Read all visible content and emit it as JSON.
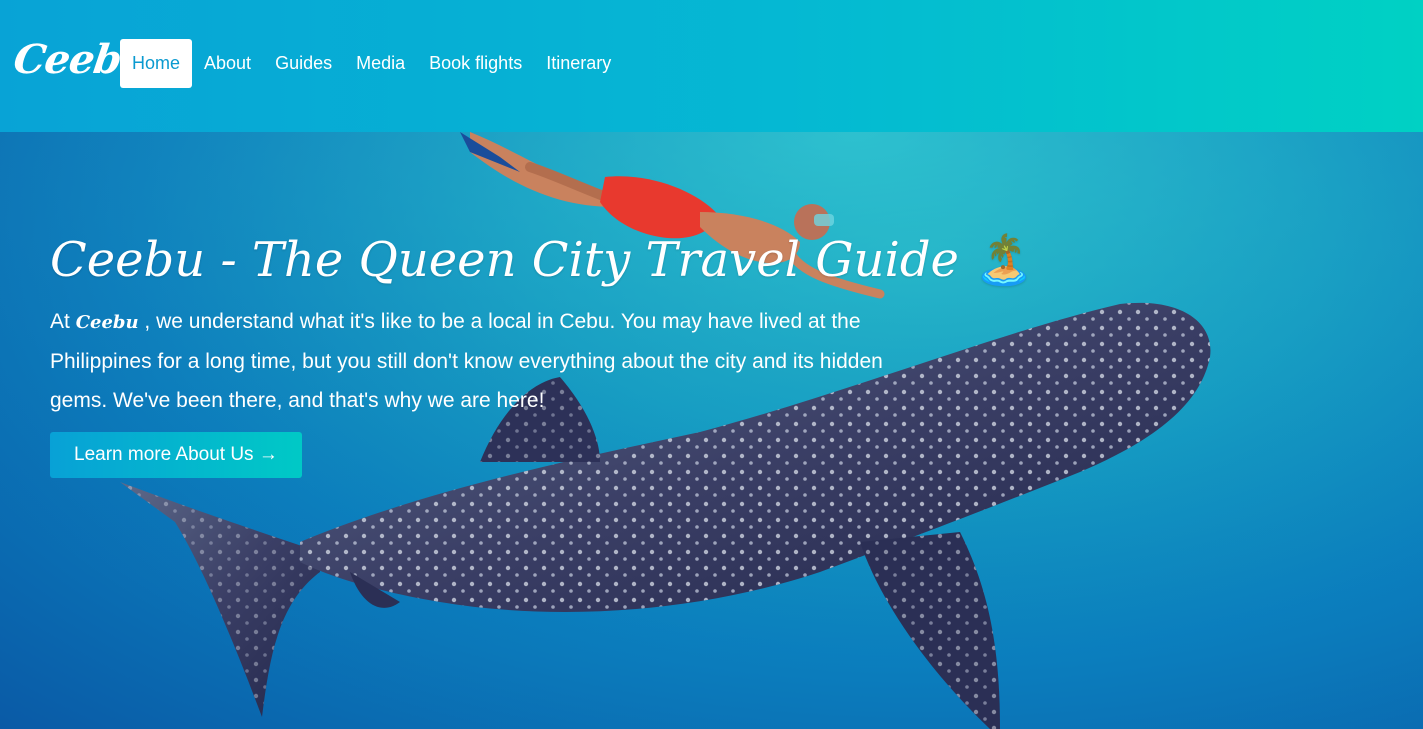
{
  "navbar": {
    "brand": "Ceebu",
    "links": [
      {
        "label": "Home",
        "active": true
      },
      {
        "label": "About",
        "active": false
      },
      {
        "label": "Guides",
        "active": false
      },
      {
        "label": "Media",
        "active": false
      },
      {
        "label": "Book flights",
        "active": false
      },
      {
        "label": "Itinerary",
        "active": false
      }
    ]
  },
  "hero": {
    "title": "Ceebu - The Queen City Travel Guide",
    "title_emoji": "🏝️",
    "text_prefix": "At ",
    "text_brand": "Ceebu",
    "text_body": " , we understand what it's like to be a local in Cebu. You may have lived at the Philippines for a long time, but you still don't know everything about the city and its hidden gems. We've been there, and that's why we are here!",
    "cta_label": "Learn more About Us →",
    "background_image": "whale-shark-and-snorkeler-photo"
  },
  "colors": {
    "nav_gradient_start": "#08a3d6",
    "nav_gradient_end": "#00d1c4",
    "active_link_text": "#0a9ad0",
    "cta_gradient_start": "#08a1d6",
    "cta_gradient_end": "#00c9c6"
  }
}
